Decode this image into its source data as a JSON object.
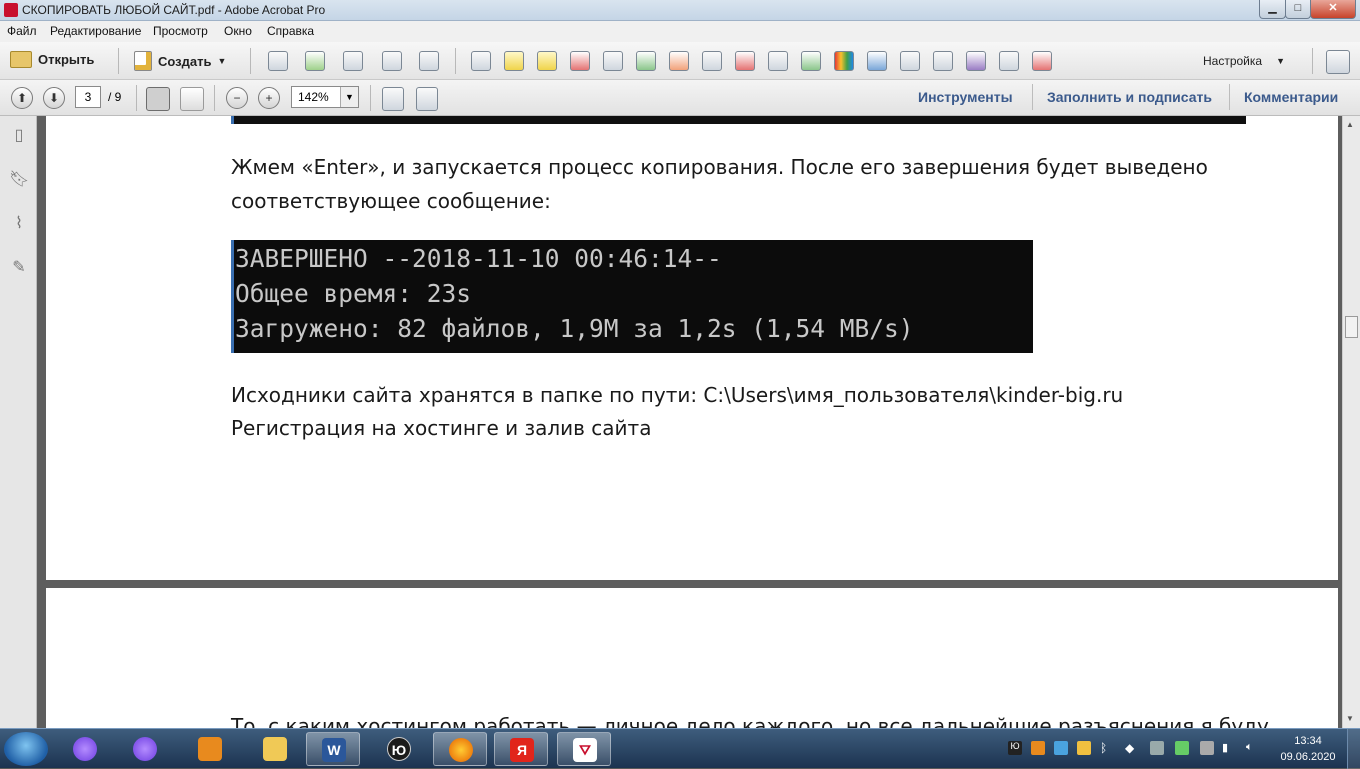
{
  "window": {
    "title": "СКОПИРОВАТЬ ЛЮБОЙ САЙТ.pdf - Adobe Acrobat Pro"
  },
  "menu": [
    "Файл",
    "Редактирование",
    "Просмотр",
    "Окно",
    "Справка"
  ],
  "toolbar": {
    "open_label": "Открыть",
    "create_label": "Создать",
    "customize_label": "Настройка"
  },
  "navigation": {
    "current_page": "3",
    "total_pages": "/ 9",
    "zoom": "142%"
  },
  "right_panels": {
    "tools": "Инструменты",
    "fill_sign": "Заполнить и подписать",
    "comments": "Комментарии"
  },
  "document": {
    "para1_line1": "Жмем «Enter», и запускается процесс копирования. После его завершения будет выведено",
    "para1_line2": "соответствующее сообщение:",
    "console_lines": [
      "ЗАВЕРШЕНО --2018-11-10 00:46:14--",
      "Общее время: 23s",
      "Загружено: 82 файлов, 1,9M за 1,2s (1,54 MB/s)"
    ],
    "para2": "Исходники сайта хранятся в папке по пути: C:\\Users\\имя_пользователя\\kinder-big.ru",
    "heading": "Регистрация на хостинге и залив сайта",
    "page2_partial": "То, с каким хостингом работать — личное дело каждого, но все дальнейшие разъяснения я буду"
  },
  "taskbar": {
    "lang": "Ю",
    "word_glyph": "W",
    "yandex_glyph": "Я",
    "time": "13:34",
    "date": "09.06.2020"
  }
}
